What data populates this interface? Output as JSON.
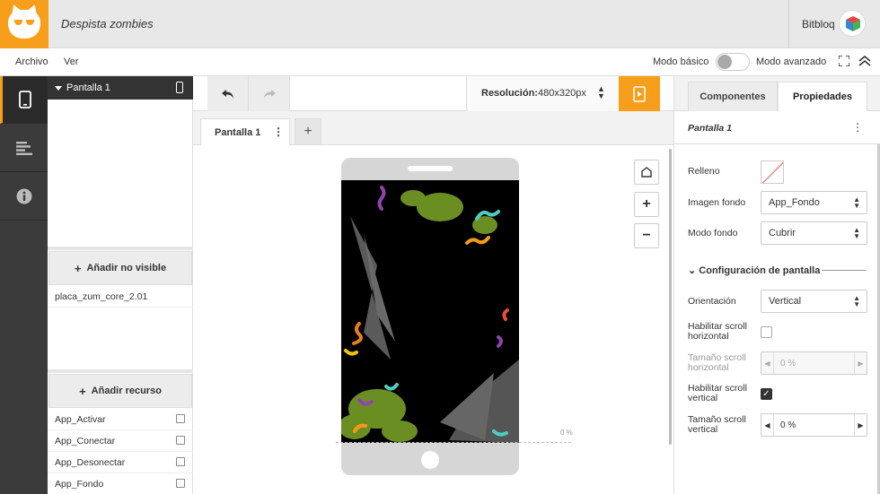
{
  "header": {
    "project_title": "Despista zombies",
    "username": "Bitbloq",
    "brand_color": "#f79e1b"
  },
  "menu": {
    "items": [
      "Archivo",
      "Ver"
    ],
    "mode_basic": "Modo básico",
    "mode_advanced": "Modo avanzado",
    "advanced_mode_on": false
  },
  "rail": {
    "items": [
      "mobile-icon",
      "components-list-icon",
      "info-icon"
    ]
  },
  "screens_panel": {
    "screen_label": "Pantalla 1",
    "add_invisible_label": "Añadir no visible",
    "invisible_components": [
      "placa_zum_core_2.01"
    ],
    "add_resource_label": "Añadir recurso",
    "resources": [
      "App_Activar",
      "App_Conectar",
      "App_Desonectar",
      "App_Fondo"
    ]
  },
  "toolbar": {
    "resolution_label": "Resolución:",
    "resolution_value": "480x320px"
  },
  "tabs": {
    "active": "Pantalla 1"
  },
  "canvas": {
    "scroll_percent": "0 %"
  },
  "properties": {
    "tab_components": "Componentes",
    "tab_properties": "Propiedades",
    "selected_title": "Pantalla 1",
    "fill_label": "Relleno",
    "bg_image_label": "Imagen fondo",
    "bg_image_value": "App_Fondo",
    "bg_mode_label": "Modo fondo",
    "bg_mode_value": "Cubrir",
    "section_title": "Configuración de pantalla",
    "orientation_label": "Orientación",
    "orientation_value": "Vertical",
    "hscroll_label": "Habilitar scroll horizontal",
    "hscroll_enabled": false,
    "hscroll_size_label": "Tamaño scroll horizontal",
    "hscroll_size_value": "0 %",
    "vscroll_label": "Habilitar scroll vertical",
    "vscroll_enabled": true,
    "vscroll_size_label": "Tamaño scroll vertical",
    "vscroll_size_value": "0 %"
  }
}
